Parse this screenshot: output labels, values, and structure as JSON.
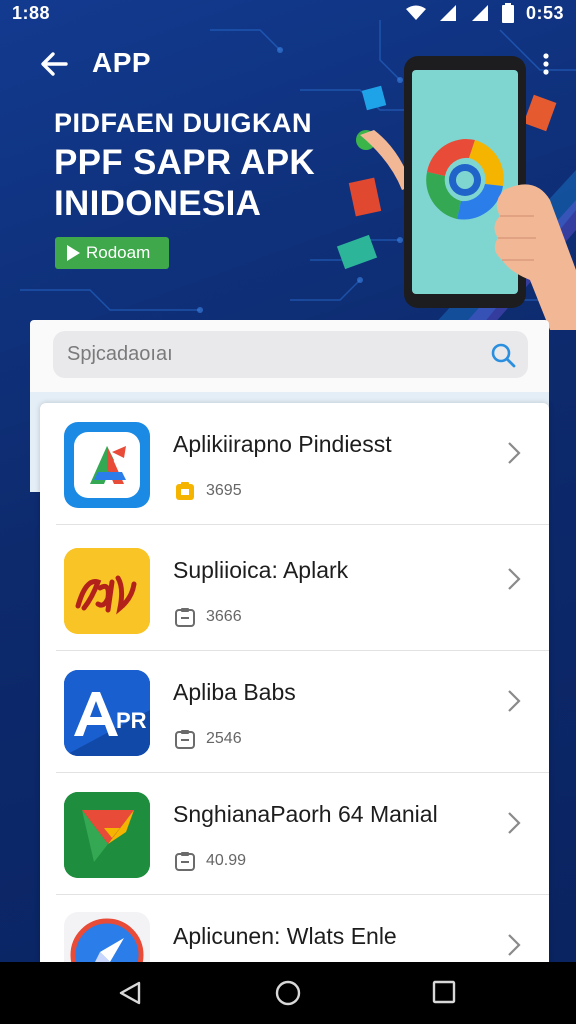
{
  "status": {
    "time": "1:88",
    "clock_right": "0:53"
  },
  "appbar": {
    "title": "APP"
  },
  "hero": {
    "line1": "PIDFAEN DUIGKAN",
    "line2": "PPF SAPR APK",
    "line3": "INIDONESIA",
    "button_label": "Rodoam"
  },
  "search": {
    "placeholder": "Spjcadaoıaı"
  },
  "apps": [
    {
      "name": "Aplikiirapno Pindiesst",
      "meta": "3695",
      "meta_color": "#f4b400"
    },
    {
      "name": "Supliioica: Aplark",
      "meta": "3666",
      "meta_color": "#6b6b6b"
    },
    {
      "name": "Apliba Babs",
      "meta": "2546",
      "meta_color": "#6b6b6b"
    },
    {
      "name": "SnghianaPaorh 64 Manial",
      "meta": "40.99",
      "meta_color": "#6b6b6b"
    },
    {
      "name": "Aplicunen: Wlats Enle",
      "meta": "",
      "meta_color": "#3ea84a"
    }
  ],
  "icons": {
    "back": "arrow-left-icon",
    "more": "more-vertical-icon",
    "search": "search-icon",
    "chevron": "chevron-right-icon",
    "nav_back": "triangle-back-icon",
    "nav_home": "circle-home-icon",
    "nav_recent": "square-recent-icon"
  },
  "colors": {
    "background": "#0f2f7a",
    "accent_green": "#3ea84a",
    "search_icon": "#2b8fe0"
  }
}
